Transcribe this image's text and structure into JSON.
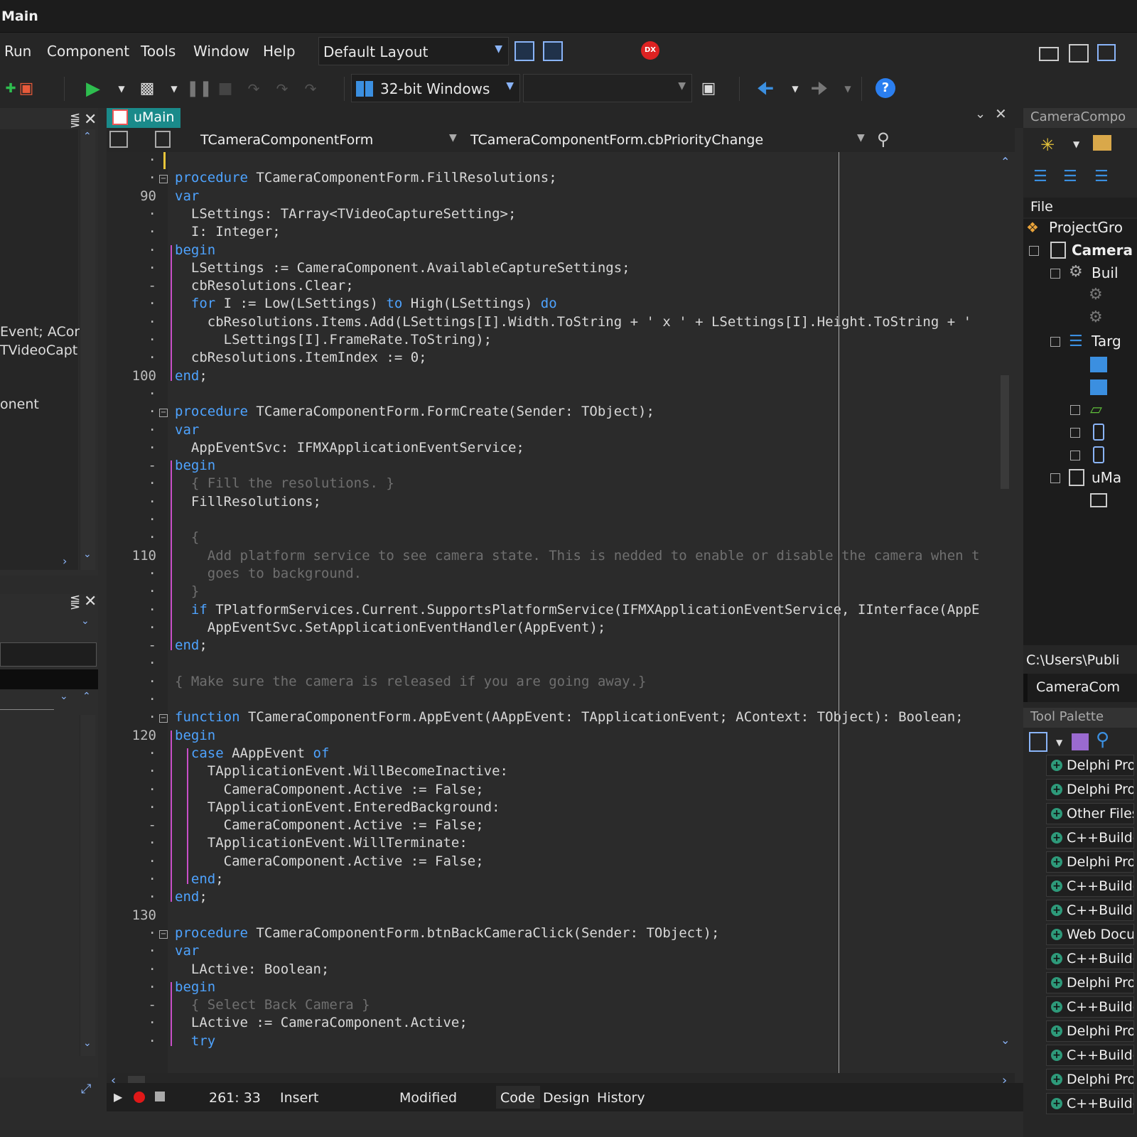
{
  "window": {
    "title": "Main"
  },
  "menu": {
    "items": [
      "Run",
      "Component",
      "Tools",
      "Window",
      "Help"
    ]
  },
  "layout_combo": {
    "value": "Default Layout"
  },
  "platform_combo": {
    "value": "32-bit Windows"
  },
  "editor_tab": {
    "label": "uMain"
  },
  "code_nav": {
    "class_combo": "TCameraComponentForm",
    "method_combo": "TCameraComponentForm.cbPriorityChange"
  },
  "left_panel": {
    "lines": [
      "Event; ACont",
      "TVideoCapt",
      "onent"
    ]
  },
  "gutter": [
    "·",
    "·",
    "90",
    "·",
    "·",
    "·",
    "·",
    "-",
    "·",
    "·",
    "·",
    "·",
    "100",
    "·",
    "·",
    "·",
    "·",
    "-",
    "·",
    "·",
    "·",
    "·",
    "110",
    "·",
    "·",
    "·",
    "·",
    "-",
    "·",
    "·",
    "·",
    "·",
    "120",
    "·",
    "·",
    "·",
    "·",
    "-",
    "·",
    "·",
    "·",
    "·",
    "130",
    "·",
    "·",
    "·",
    "·",
    "-",
    "·",
    "·"
  ],
  "code_lines": [
    "",
    "procedure TCameraComponentForm.FillResolutions;",
    "var",
    "  LSettings: TArray<TVideoCaptureSetting>;",
    "  I: Integer;",
    "begin",
    "  LSettings := CameraComponent.AvailableCaptureSettings;",
    "  cbResolutions.Clear;",
    "  for I := Low(LSettings) to High(LSettings) do",
    "    cbResolutions.Items.Add(LSettings[I].Width.ToString + ' x ' + LSettings[I].Height.ToString + '",
    "      LSettings[I].FrameRate.ToString);",
    "  cbResolutions.ItemIndex := 0;",
    "end;",
    "",
    "procedure TCameraComponentForm.FormCreate(Sender: TObject);",
    "var",
    "  AppEventSvc: IFMXApplicationEventService;",
    "begin",
    "  { Fill the resolutions. }",
    "  FillResolutions;",
    "",
    "  {",
    "    Add platform service to see camera state. This is nedded to enable or disable the camera when t",
    "    goes to background.",
    "  }",
    "  if TPlatformServices.Current.SupportsPlatformService(IFMXApplicationEventService, IInterface(AppE",
    "    AppEventSvc.SetApplicationEventHandler(AppEvent);",
    "end;",
    "",
    "{ Make sure the camera is released if you are going away.}",
    "",
    "function TCameraComponentForm.AppEvent(AAppEvent: TApplicationEvent; AContext: TObject): Boolean;",
    "begin",
    "  case AAppEvent of",
    "    TApplicationEvent.WillBecomeInactive:",
    "      CameraComponent.Active := False;",
    "    TApplicationEvent.EnteredBackground:",
    "      CameraComponent.Active := False;",
    "    TApplicationEvent.WillTerminate:",
    "      CameraComponent.Active := False;",
    "  end;",
    "end;",
    "",
    "procedure TCameraComponentForm.btnBackCameraClick(Sender: TObject);",
    "var",
    "  LActive: Boolean;",
    "begin",
    "  { Select Back Camera }",
    "  LActive := CameraComponent.Active;",
    "  try"
  ],
  "right_panel": {
    "title": "CameraCompo",
    "file_header": "File",
    "tree": [
      "ProjectGro",
      "Camera",
      "Buil",
      "",
      "",
      "Targ",
      "",
      "",
      "",
      "",
      "",
      "uMa",
      ""
    ],
    "path": "C:\\Users\\Publi",
    "project_combo": "CameraCom",
    "tool_palette_title": "Tool Palette",
    "palette_items": [
      "Delphi Proj",
      "Delphi Proj",
      "Other Files",
      "C++Builde",
      "Delphi Proj",
      "C++Builde",
      "C++Builde",
      "Web Docu",
      "C++Builde",
      "Delphi Proj",
      "C++Builde",
      "Delphi Proj",
      "C++Builde",
      "Delphi Proj",
      "C++Builde"
    ]
  },
  "status": {
    "position": "261: 33",
    "mode": "Insert",
    "modified": "Modified",
    "tabs": [
      "Code",
      "Design",
      "History"
    ]
  },
  "colors": {
    "keyword": "#4ea3ff",
    "comment": "#6f6f6f",
    "bracket": "#c84fc8",
    "tab_active": "#1a8a8a",
    "run_green": "#2ebd4f",
    "help_blue": "#2b7ff0"
  }
}
